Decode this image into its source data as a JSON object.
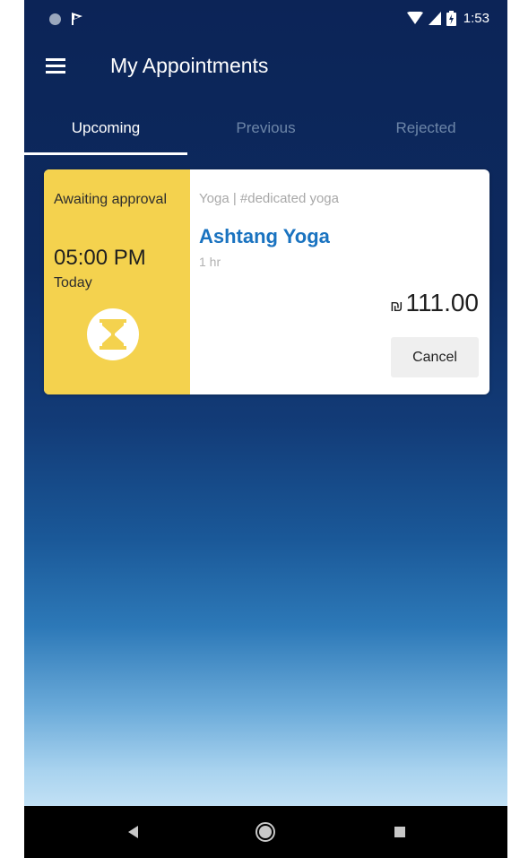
{
  "status_bar": {
    "time": "1:53"
  },
  "header": {
    "title": "My Appointments"
  },
  "tabs": [
    {
      "label": "Upcoming",
      "active": true
    },
    {
      "label": "Previous",
      "active": false
    },
    {
      "label": "Rejected",
      "active": false
    }
  ],
  "appointment": {
    "status": "Awaiting approval",
    "time": "05:00 PM",
    "day": "Today",
    "status_icon": "hourglass-icon",
    "category": "Yoga | #dedicated yoga",
    "service": "Ashtang Yoga",
    "duration": "1 hr",
    "currency": "₪",
    "price": "111.00",
    "cancel_label": "Cancel"
  },
  "colors": {
    "status_panel": "#f4d24e",
    "service_title": "#1a73c0",
    "background_top": "#0c2457",
    "background_bottom": "#c2e1f5"
  }
}
